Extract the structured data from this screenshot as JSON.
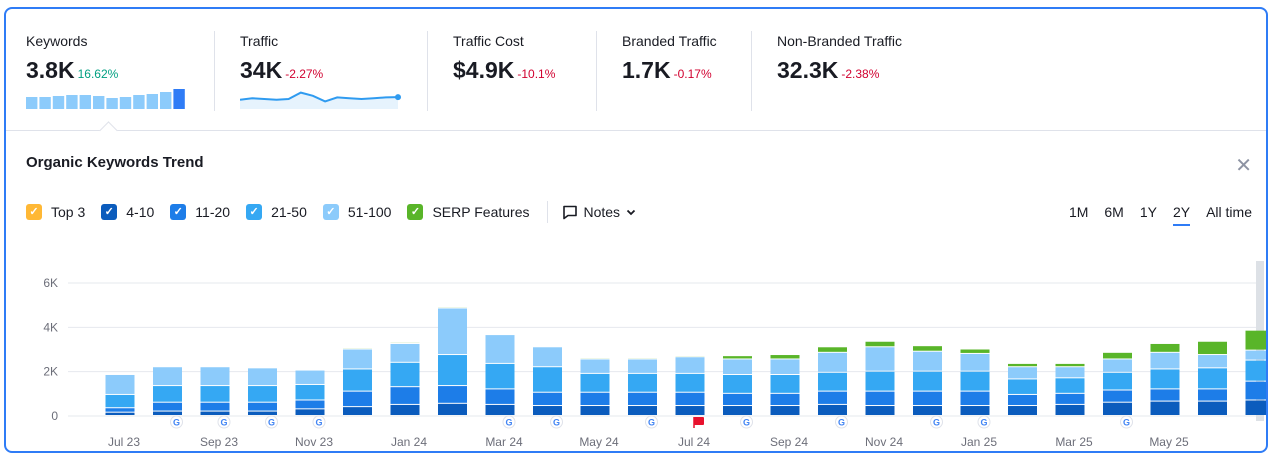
{
  "metrics": [
    {
      "label": "Keywords",
      "value": "3.8K",
      "delta": "16.62%",
      "trend": "pos",
      "spark": "bars",
      "spark_values": [
        0.6,
        0.6,
        0.65,
        0.7,
        0.7,
        0.65,
        0.55,
        0.6,
        0.7,
        0.75,
        0.85,
        1.0
      ]
    },
    {
      "label": "Traffic",
      "value": "34K",
      "delta": "-2.27%",
      "trend": "neg",
      "spark": "line",
      "spark_values": [
        0.45,
        0.55,
        0.5,
        0.45,
        0.5,
        0.9,
        0.7,
        0.35,
        0.6,
        0.55,
        0.5,
        0.55,
        0.6,
        0.62
      ]
    },
    {
      "label": "Traffic Cost",
      "value": "$4.9K",
      "delta": "-10.1%",
      "trend": "neg"
    },
    {
      "label": "Branded Traffic",
      "value": "1.7K",
      "delta": "-0.17%",
      "trend": "neg"
    },
    {
      "label": "Non-Branded Traffic",
      "value": "32.3K",
      "delta": "-2.38%",
      "trend": "neg"
    }
  ],
  "panel": {
    "title": "Organic Keywords Trend",
    "close_icon": "close-icon",
    "notes_label": "Notes"
  },
  "legend": [
    {
      "label": "Top 3",
      "color": "#ffb835",
      "checked": true
    },
    {
      "label": "4-10",
      "color": "#0b5cbd",
      "checked": true
    },
    {
      "label": "11-20",
      "color": "#1d7de8",
      "checked": true
    },
    {
      "label": "21-50",
      "color": "#35a8f3",
      "checked": true
    },
    {
      "label": "51-100",
      "color": "#8ccbfb",
      "checked": true
    },
    {
      "label": "SERP Features",
      "color": "#59b529",
      "checked": true
    }
  ],
  "ranges": [
    {
      "label": "1M",
      "active": false
    },
    {
      "label": "6M",
      "active": false
    },
    {
      "label": "1Y",
      "active": false
    },
    {
      "label": "2Y",
      "active": true
    },
    {
      "label": "All time",
      "active": false
    }
  ],
  "chart_data": {
    "type": "bar",
    "stacked": true,
    "ylim": [
      0,
      6000
    ],
    "yticks": [
      {
        "v": 0,
        "label": "0"
      },
      {
        "v": 2000,
        "label": "2K"
      },
      {
        "v": 4000,
        "label": "4K"
      },
      {
        "v": 6000,
        "label": "6K"
      }
    ],
    "xlabels": [
      {
        "i": 0,
        "label": "Jul 23"
      },
      {
        "i": 2,
        "label": "Sep 23"
      },
      {
        "i": 4,
        "label": "Nov 23"
      },
      {
        "i": 6,
        "label": "Jan 24"
      },
      {
        "i": 8,
        "label": "Mar 24"
      },
      {
        "i": 10,
        "label": "May 24"
      },
      {
        "i": 12,
        "label": "Jul 24"
      },
      {
        "i": 14,
        "label": "Sep 24"
      },
      {
        "i": 16,
        "label": "Nov 24"
      },
      {
        "i": 18,
        "label": "Jan 25"
      },
      {
        "i": 20,
        "label": "Mar 25"
      },
      {
        "i": 22,
        "label": "May 25"
      }
    ],
    "series": [
      {
        "name": "Top 3",
        "color": "#ffb835",
        "values": [
          0,
          0,
          0,
          0,
          0,
          0,
          0,
          0,
          0,
          0,
          0,
          0,
          0,
          0,
          0,
          0,
          0,
          0,
          0,
          0,
          0,
          0,
          0,
          0,
          0
        ]
      },
      {
        "name": "4-10",
        "color": "#0b5cbd",
        "values": [
          150,
          200,
          200,
          200,
          300,
          400,
          500,
          550,
          500,
          450,
          450,
          450,
          450,
          450,
          450,
          500,
          450,
          450,
          450,
          450,
          500,
          600,
          650,
          650,
          700
        ]
      },
      {
        "name": "11-20",
        "color": "#1d7de8",
        "values": [
          200,
          400,
          400,
          400,
          400,
          700,
          800,
          800,
          700,
          600,
          600,
          600,
          600,
          550,
          550,
          600,
          650,
          650,
          650,
          500,
          500,
          550,
          550,
          550,
          850
        ]
      },
      {
        "name": "21-50",
        "color": "#35a8f3",
        "values": [
          600,
          750,
          750,
          750,
          700,
          1000,
          1100,
          1400,
          1150,
          1150,
          850,
          850,
          850,
          850,
          850,
          850,
          900,
          900,
          900,
          700,
          700,
          800,
          900,
          950,
          950
        ]
      },
      {
        "name": "51-100",
        "color": "#8ccbfb",
        "values": [
          900,
          850,
          850,
          800,
          650,
          900,
          850,
          2100,
          1300,
          900,
          650,
          650,
          750,
          700,
          700,
          900,
          1100,
          900,
          800,
          550,
          500,
          600,
          750,
          600,
          450
        ]
      },
      {
        "name": "SERP Features",
        "color": "#59b529",
        "values": [
          0,
          0,
          0,
          0,
          30,
          50,
          50,
          50,
          30,
          30,
          50,
          50,
          50,
          150,
          200,
          250,
          250,
          250,
          200,
          150,
          150,
          300,
          400,
          600,
          900
        ]
      }
    ],
    "markers": [
      {
        "i": 1,
        "type": "google"
      },
      {
        "i": 2,
        "type": "google"
      },
      {
        "i": 3,
        "type": "google"
      },
      {
        "i": 4,
        "type": "google"
      },
      {
        "i": 8,
        "type": "google"
      },
      {
        "i": 9,
        "type": "google"
      },
      {
        "i": 11,
        "type": "google"
      },
      {
        "i": 12,
        "type": "flag"
      },
      {
        "i": 13,
        "type": "google"
      },
      {
        "i": 15,
        "type": "google"
      },
      {
        "i": 17,
        "type": "google"
      },
      {
        "i": 18,
        "type": "google"
      },
      {
        "i": 21,
        "type": "google"
      }
    ],
    "highlighted_index": 24
  }
}
